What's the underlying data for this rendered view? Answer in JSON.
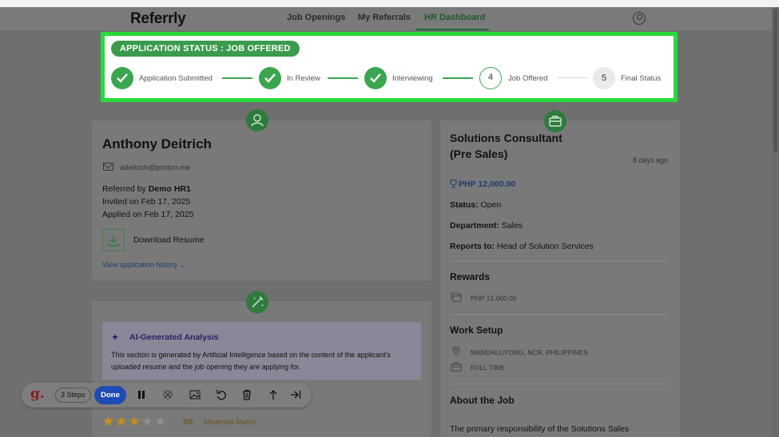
{
  "header": {
    "logo": "Referrly",
    "nav": [
      {
        "label": "Job Openings"
      },
      {
        "label": "My Referrals"
      },
      {
        "label": "HR Dashboard",
        "active": true
      }
    ]
  },
  "status": {
    "pill": "APPLICATION STATUS : JOB OFFERED",
    "steps": [
      {
        "label": "Application Submitted",
        "state": "done"
      },
      {
        "label": "In Review",
        "state": "done"
      },
      {
        "label": "Interviewing",
        "state": "done"
      },
      {
        "label": "Job Offered",
        "state": "current",
        "number": "4"
      },
      {
        "label": "Final Status",
        "state": "pending",
        "number": "5"
      }
    ]
  },
  "candidate": {
    "name": "Anthony Deitrich",
    "email": "adeitrich@proton.me",
    "referred_prefix": "Referred by ",
    "referred_by": "Demo HR1",
    "invited": "Invited on Feb 17, 2025",
    "applied": "Applied on Feb 17, 2025",
    "download_label": "Download Resume",
    "history_link": "View application history"
  },
  "analysis": {
    "title": "AI-Generated Analysis",
    "text": "This section is generated by Artificial Intelligence based on the content of the applicant's uploaded resume and the job opening they are applying for.",
    "rating": 3,
    "rating_max": 5,
    "score_text": "3/5",
    "match_label": "Moderate Match"
  },
  "job": {
    "title": "Solutions Consultant (Pre Sales)",
    "posted": "8 days ago",
    "salary": "PHP 12,000.00",
    "status_label": "Status:",
    "status_value": "Open",
    "department_label": "Department:",
    "department_value": "Sales",
    "reports_label": "Reports to:",
    "reports_value": "Head of Solution Services",
    "rewards_heading": "Rewards",
    "reward_value": "PHP 12,000.00",
    "work_setup_heading": "Work Setup",
    "location": "MANDALUYONG, NCR, PHILIPPINES",
    "employment_type": "FULL TIME",
    "about_heading": "About the Job",
    "about_text": "The primary responsibility of the Solutions Sales"
  },
  "toolbar": {
    "logo": "g.",
    "steps": "3 Steps",
    "done": "Done"
  },
  "colors": {
    "accent_green": "#3aa64f",
    "highlight_border": "#27d93a",
    "done_button": "#1f4bb4",
    "star_filled": "#c8901a"
  }
}
